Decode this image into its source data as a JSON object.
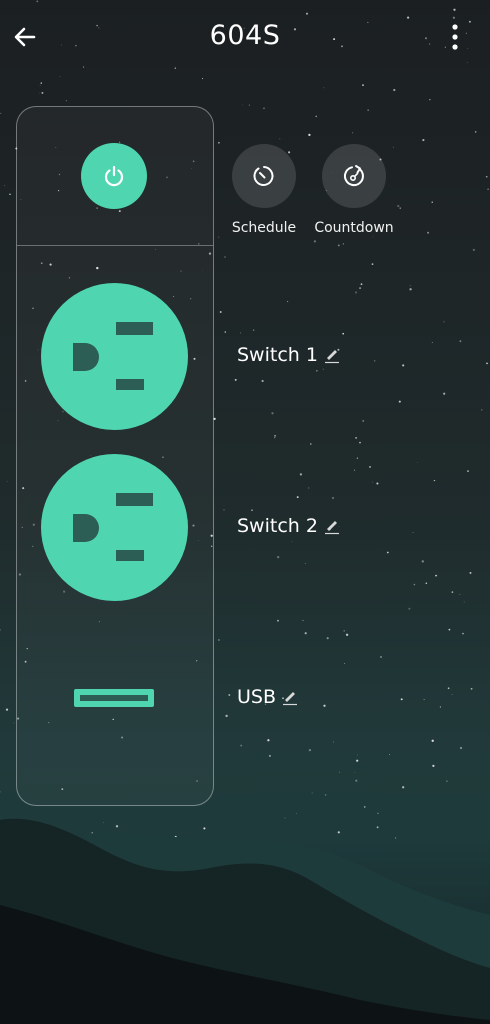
{
  "header": {
    "title": "604S",
    "back_icon": "arrow-left-icon",
    "more_icon": "more-vertical-icon"
  },
  "panel": {
    "power_icon": "power-icon",
    "outlets": [
      {
        "id": "outlet-1",
        "state": "on"
      },
      {
        "id": "outlet-2",
        "state": "on"
      }
    ],
    "usb_state": "on"
  },
  "actions": {
    "schedule": {
      "label": "Schedule",
      "icon": "clock-icon"
    },
    "countdown": {
      "label": "Countdown",
      "icon": "countdown-timer-icon"
    }
  },
  "switches": [
    {
      "name": "Switch 1",
      "edit_icon": "pencil-icon"
    },
    {
      "name": "Switch 2",
      "edit_icon": "pencil-icon"
    },
    {
      "name": "USB",
      "edit_icon": "pencil-icon"
    }
  ],
  "colors": {
    "accent": "#4fd6b1",
    "background_top": "#1b1f21",
    "background_bottom": "#1e3a3b"
  }
}
